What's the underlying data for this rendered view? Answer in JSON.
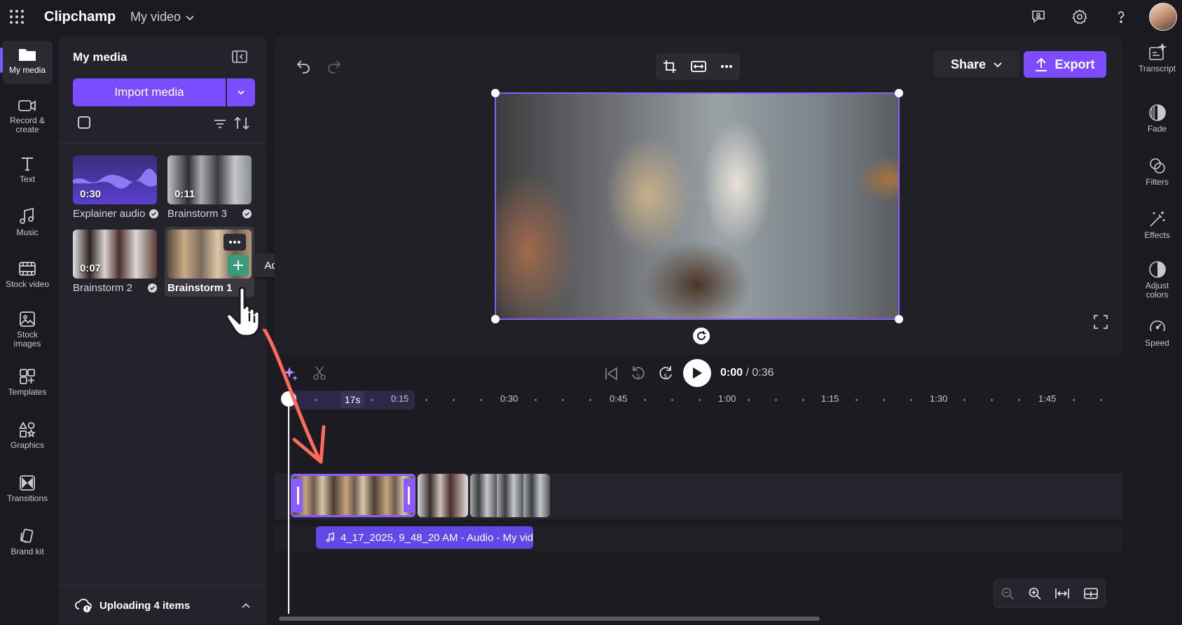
{
  "app": {
    "title": "Clipchamp",
    "project_title": "My video"
  },
  "left_rail": [
    {
      "label": "My media",
      "icon": "folder-icon"
    },
    {
      "label": "Record &\ncreate",
      "icon": "camera-icon"
    },
    {
      "label": "Text",
      "icon": "text-icon"
    },
    {
      "label": "Music",
      "icon": "music-icon"
    },
    {
      "label": "Stock video",
      "icon": "film-icon"
    },
    {
      "label": "Stock\nimages",
      "icon": "image-icon"
    },
    {
      "label": "Templates",
      "icon": "templates-icon"
    },
    {
      "label": "Graphics",
      "icon": "shapes-icon"
    },
    {
      "label": "Transitions",
      "icon": "transitions-icon"
    },
    {
      "label": "Brand kit",
      "icon": "brand-kit-icon"
    }
  ],
  "media_panel": {
    "title": "My media",
    "import_label": "Import media",
    "items": [
      {
        "name": "Explainer audio",
        "duration": "0:30"
      },
      {
        "name": "Brainstorm 3",
        "duration": "0:11"
      },
      {
        "name": "Brainstorm 2",
        "duration": "0:07"
      },
      {
        "name": "Brainstorm 1",
        "duration": ""
      }
    ],
    "tooltip": "Add to timeline",
    "upload_status": "Uploading 4 items"
  },
  "toolbar": {
    "share_label": "Share",
    "export_label": "Export"
  },
  "playback": {
    "current_time": "0:00",
    "total_time": "/ 0:36"
  },
  "ruler": {
    "playhead_label": "17s",
    "labels": [
      "0:15",
      "0:30",
      "0:45",
      "1:00",
      "1:15",
      "1:30",
      "1:45"
    ]
  },
  "timeline": {
    "audio_clip_label": "4_17_2025, 9_48_20 AM - Audio - My vid"
  },
  "right_rail": [
    {
      "label": "Transcript",
      "icon": "transcript-icon"
    },
    {
      "label": "Fade",
      "icon": "fade-icon"
    },
    {
      "label": "Filters",
      "icon": "filters-icon"
    },
    {
      "label": "Effects",
      "icon": "effects-icon"
    },
    {
      "label": "Adjust\ncolors",
      "icon": "adjust-colors-icon"
    },
    {
      "label": "Speed",
      "icon": "speed-icon"
    }
  ],
  "colors": {
    "accent": "#7c4dff",
    "selection": "#8c5cff",
    "add_button": "#3a9b7a"
  }
}
